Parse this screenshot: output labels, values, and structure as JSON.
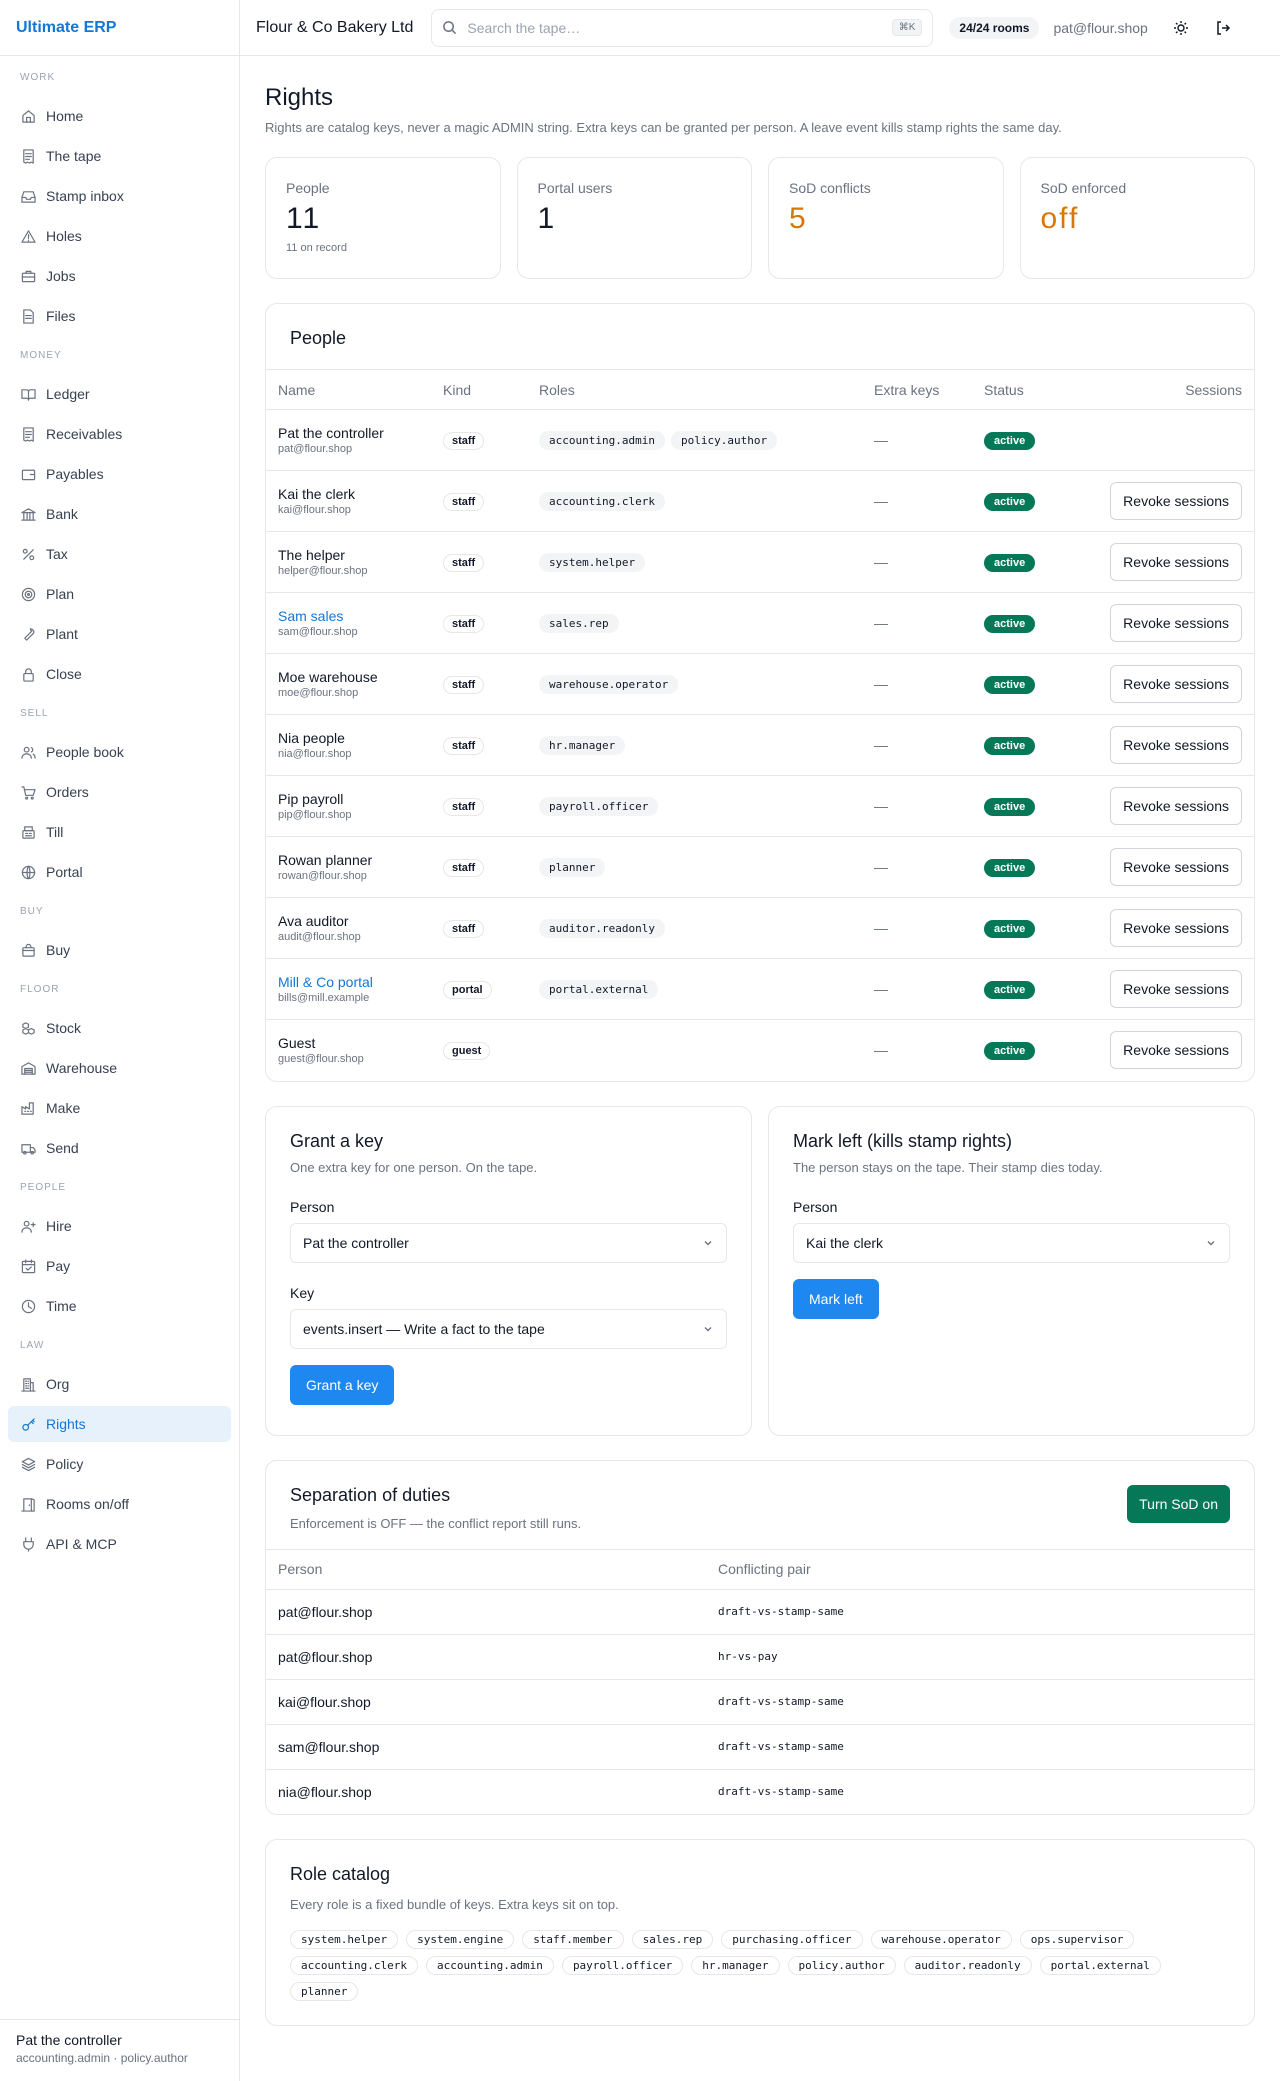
{
  "brand": "Ultimate ERP",
  "topbar": {
    "org": "Flour & Co Bakery Ltd",
    "search_placeholder": "Search the tape…",
    "kbd": "⌘K",
    "rooms": "24/24 rooms",
    "user": "pat@flour.shop"
  },
  "nav": [
    {
      "section": "WORK",
      "items": [
        {
          "label": "Home",
          "icon": "home"
        },
        {
          "label": "The tape",
          "icon": "receipt"
        },
        {
          "label": "Stamp inbox",
          "icon": "inbox"
        },
        {
          "label": "Holes",
          "icon": "warning"
        },
        {
          "label": "Jobs",
          "icon": "briefcase"
        },
        {
          "label": "Files",
          "icon": "file"
        }
      ]
    },
    {
      "section": "MONEY",
      "items": [
        {
          "label": "Ledger",
          "icon": "book"
        },
        {
          "label": "Receivables",
          "icon": "receipt"
        },
        {
          "label": "Payables",
          "icon": "wallet"
        },
        {
          "label": "Bank",
          "icon": "bank"
        },
        {
          "label": "Tax",
          "icon": "percent"
        },
        {
          "label": "Plan",
          "icon": "target"
        },
        {
          "label": "Plant",
          "icon": "wrench"
        },
        {
          "label": "Close",
          "icon": "lock"
        }
      ]
    },
    {
      "section": "SELL",
      "items": [
        {
          "label": "People book",
          "icon": "users"
        },
        {
          "label": "Orders",
          "icon": "cart"
        },
        {
          "label": "Till",
          "icon": "register"
        },
        {
          "label": "Portal",
          "icon": "globe"
        }
      ]
    },
    {
      "section": "BUY",
      "items": [
        {
          "label": "Buy",
          "icon": "bag"
        }
      ]
    },
    {
      "section": "FLOOR",
      "items": [
        {
          "label": "Stock",
          "icon": "boxes"
        },
        {
          "label": "Warehouse",
          "icon": "warehouse"
        },
        {
          "label": "Make",
          "icon": "factory"
        },
        {
          "label": "Send",
          "icon": "truck"
        }
      ]
    },
    {
      "section": "PEOPLE",
      "items": [
        {
          "label": "Hire",
          "icon": "user-plus"
        },
        {
          "label": "Pay",
          "icon": "calendar-check"
        },
        {
          "label": "Time",
          "icon": "clock"
        }
      ]
    },
    {
      "section": "LAW",
      "items": [
        {
          "label": "Org",
          "icon": "building"
        },
        {
          "label": "Rights",
          "icon": "key",
          "active": true
        },
        {
          "label": "Policy",
          "icon": "layers"
        },
        {
          "label": "Rooms on/off",
          "icon": "door"
        },
        {
          "label": "API & MCP",
          "icon": "plug"
        }
      ]
    }
  ],
  "sidebar_footer": {
    "name": "Pat the controller",
    "roles": "accounting.admin · policy.author"
  },
  "page": {
    "title": "Rights",
    "subtitle": "Rights are catalog keys, never a magic ADMIN string. Extra keys can be granted per person. A leave event kills stamp rights the same day."
  },
  "stats": [
    {
      "label": "People",
      "value": "11",
      "note": "11 on record"
    },
    {
      "label": "Portal users",
      "value": "1",
      "note": ""
    },
    {
      "label": "SoD conflicts",
      "value": "5",
      "note": "",
      "color": "#d97706"
    },
    {
      "label": "SoD enforced",
      "value": "off",
      "note": "",
      "color": "#d97706"
    }
  ],
  "people": {
    "title": "People",
    "columns": [
      "Name",
      "Kind",
      "Roles",
      "Extra keys",
      "Status",
      "Sessions"
    ],
    "revoke_label": "Revoke sessions",
    "rows": [
      {
        "name": "Pat the controller",
        "email": "pat@flour.shop",
        "kind": "staff",
        "roles": [
          "accounting.admin",
          "policy.author"
        ],
        "extra": "—",
        "status": "active",
        "revoke": false
      },
      {
        "name": "Kai the clerk",
        "email": "kai@flour.shop",
        "kind": "staff",
        "roles": [
          "accounting.clerk"
        ],
        "extra": "—",
        "status": "active",
        "revoke": true
      },
      {
        "name": "The helper",
        "email": "helper@flour.shop",
        "kind": "staff",
        "roles": [
          "system.helper"
        ],
        "extra": "—",
        "status": "active",
        "revoke": true
      },
      {
        "name": "Sam sales",
        "email": "sam@flour.shop",
        "kind": "staff",
        "roles": [
          "sales.rep"
        ],
        "extra": "—",
        "status": "active",
        "revoke": true,
        "link": true
      },
      {
        "name": "Moe warehouse",
        "email": "moe@flour.shop",
        "kind": "staff",
        "roles": [
          "warehouse.operator"
        ],
        "extra": "—",
        "status": "active",
        "revoke": true
      },
      {
        "name": "Nia people",
        "email": "nia@flour.shop",
        "kind": "staff",
        "roles": [
          "hr.manager"
        ],
        "extra": "—",
        "status": "active",
        "revoke": true
      },
      {
        "name": "Pip payroll",
        "email": "pip@flour.shop",
        "kind": "staff",
        "roles": [
          "payroll.officer"
        ],
        "extra": "—",
        "status": "active",
        "revoke": true
      },
      {
        "name": "Rowan planner",
        "email": "rowan@flour.shop",
        "kind": "staff",
        "roles": [
          "planner"
        ],
        "extra": "—",
        "status": "active",
        "revoke": true
      },
      {
        "name": "Ava auditor",
        "email": "audit@flour.shop",
        "kind": "staff",
        "roles": [
          "auditor.readonly"
        ],
        "extra": "—",
        "status": "active",
        "revoke": true
      },
      {
        "name": "Mill & Co portal",
        "email": "bills@mill.example",
        "kind": "portal",
        "roles": [
          "portal.external"
        ],
        "extra": "—",
        "status": "active",
        "revoke": true,
        "link": true
      },
      {
        "name": "Guest",
        "email": "guest@flour.shop",
        "kind": "guest",
        "roles": [],
        "extra": "—",
        "status": "active",
        "revoke": true
      }
    ]
  },
  "grant": {
    "title": "Grant a key",
    "desc": "One extra key for one person. On the tape.",
    "person_label": "Person",
    "person_value": "Pat the controller",
    "key_label": "Key",
    "key_value": "events.insert — Write a fact to the tape",
    "button": "Grant a key"
  },
  "leave": {
    "title": "Mark left (kills stamp rights)",
    "desc": "The person stays on the tape. Their stamp dies today.",
    "person_label": "Person",
    "person_value": "Kai the clerk",
    "button": "Mark left"
  },
  "sod": {
    "title": "Separation of duties",
    "desc": "Enforcement is OFF — the conflict report still runs.",
    "button": "Turn SoD on",
    "columns": [
      "Person",
      "Conflicting pair"
    ],
    "rows": [
      {
        "person": "pat@flour.shop",
        "pair": "draft-vs-stamp-same"
      },
      {
        "person": "pat@flour.shop",
        "pair": "hr-vs-pay"
      },
      {
        "person": "kai@flour.shop",
        "pair": "draft-vs-stamp-same"
      },
      {
        "person": "sam@flour.shop",
        "pair": "draft-vs-stamp-same"
      },
      {
        "person": "nia@flour.shop",
        "pair": "draft-vs-stamp-same"
      }
    ]
  },
  "catalog": {
    "title": "Role catalog",
    "desc": "Every role is a fixed bundle of keys. Extra keys sit on top.",
    "roles": [
      "system.helper",
      "system.engine",
      "staff.member",
      "sales.rep",
      "purchasing.officer",
      "warehouse.operator",
      "ops.supervisor",
      "accounting.clerk",
      "accounting.admin",
      "payroll.officer",
      "hr.manager",
      "policy.author",
      "auditor.readonly",
      "portal.external",
      "planner"
    ]
  },
  "colors": {
    "accent": "#1277d6",
    "button": "#1e88f0",
    "active_badge": "#047857",
    "warning": "#d97706"
  }
}
